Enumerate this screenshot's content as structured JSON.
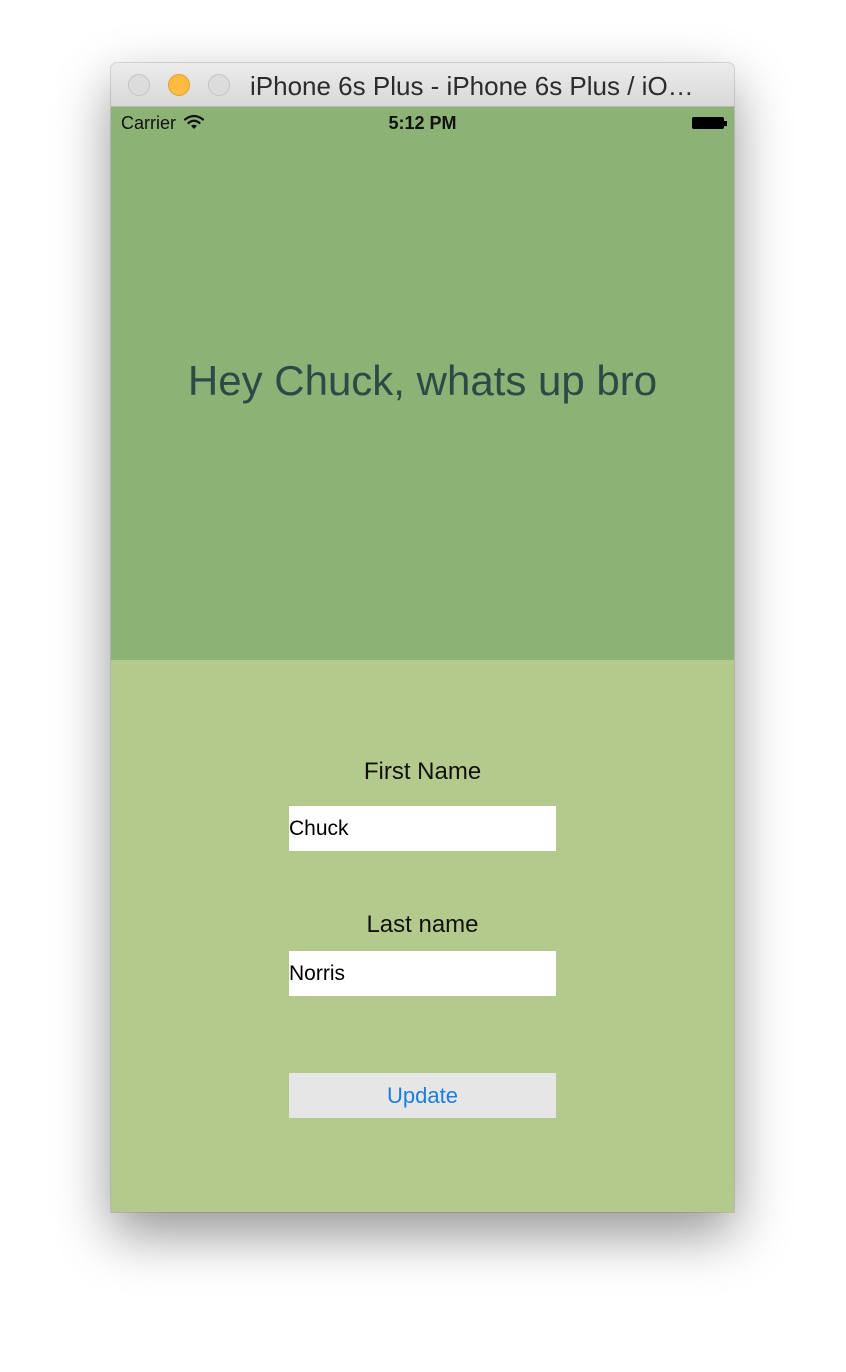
{
  "window": {
    "title": "iPhone 6s Plus - iPhone 6s Plus / iO…"
  },
  "status_bar": {
    "carrier": "Carrier",
    "time": "5:12 PM"
  },
  "greeting": "Hey Chuck, whats up bro",
  "form": {
    "first_name_label": "First Name",
    "first_name_value": "Chuck",
    "last_name_label": "Last name",
    "last_name_value": "Norris",
    "update_label": "Update"
  },
  "colors": {
    "top_panel": "#8db275",
    "bottom_panel": "#b4ca8c",
    "greeting_text": "#2e4a46",
    "button_text": "#1a7fe0",
    "minimize_button": "#fdbc40"
  },
  "icons": {
    "wifi": "wifi-icon",
    "battery": "battery-icon"
  }
}
